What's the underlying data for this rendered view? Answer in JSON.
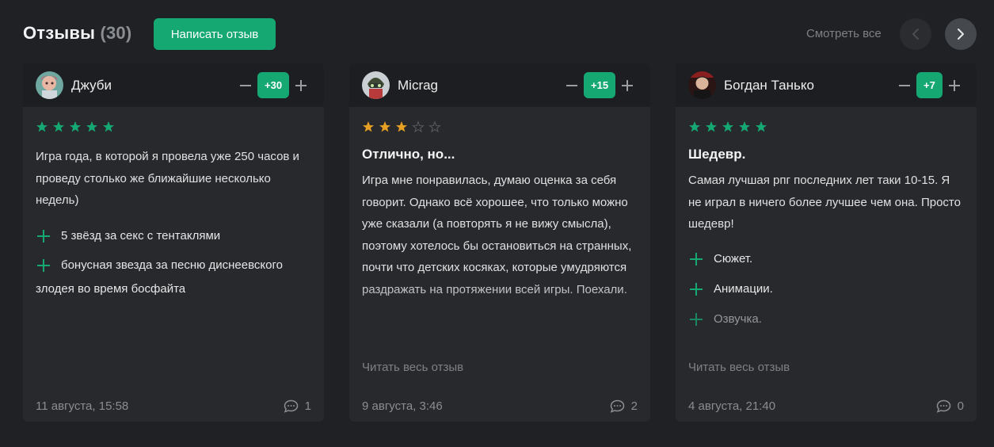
{
  "header": {
    "title": "Отзывы",
    "count": "(30)",
    "write_button": "Написать отзыв",
    "see_all": "Смотреть все",
    "accent_color": "#15a873"
  },
  "reviews": [
    {
      "user": "Джуби",
      "score": "+30",
      "rating": 5,
      "title": "",
      "text": "Игра года, в которой я провела уже 250 часов и проведу столько же ближайшие несколько недель)",
      "pros": [
        "5 звёзд за секс с тентаклями",
        "бонусная звезда за песню диснеевского злодея во время босфайта"
      ],
      "read_more": "",
      "date": "11 августа, 15:58",
      "comments": "1"
    },
    {
      "user": "Micrag",
      "score": "+15",
      "rating": 3,
      "title": "Отлично, но...",
      "text": "Игра мне понравилась, думаю оценка за себя говорит. Однако всё хорошее, что только можно уже сказали (а повторять я не вижу смысла), поэтому хотелось бы остановиться на странных, почти что детских косяках, которые умудряются раздражать на протяжении всей игры. Поехали.",
      "pros": [],
      "read_more": "Читать весь отзыв",
      "date": "9 августа, 3:46",
      "comments": "2"
    },
    {
      "user": "Богдан Танько",
      "score": "+7",
      "rating": 5,
      "title": "Шедевр.",
      "text": "Самая лучшая рпг последних лет таки 10-15. Я не играл в ничего более лучшее чем она. Просто шедевр!",
      "pros": [
        "Сюжет.",
        "Анимации.",
        "Озвучка."
      ],
      "read_more": "Читать весь отзыв",
      "date": "4 августа, 21:40",
      "comments": "0"
    }
  ]
}
